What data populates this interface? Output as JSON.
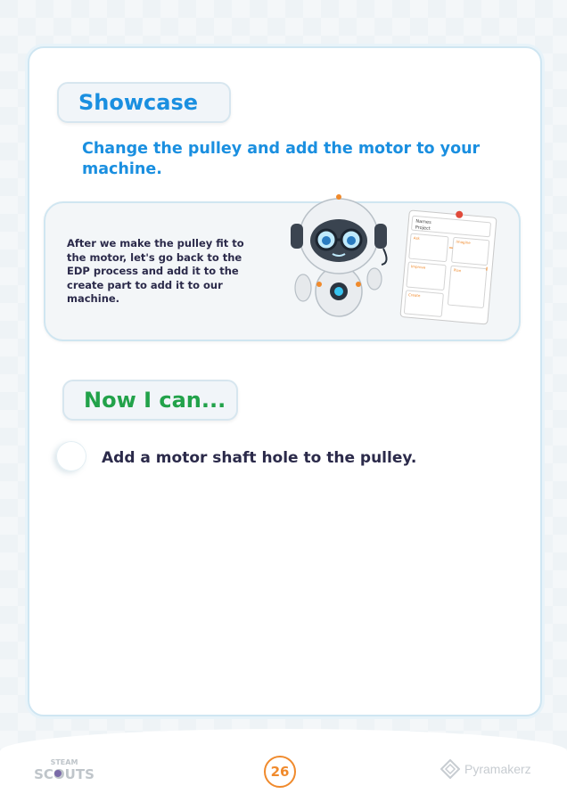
{
  "showcase": {
    "title": "Showcase",
    "subheading": "Change the pulley and add the motor to your machine.",
    "info_text": "After we make the pulley fit to the motor, let's go back to the EDP process and add it to the create part to add it to our machine.",
    "worksheet": {
      "header_lines": [
        "Names",
        "Project"
      ],
      "box_labels": [
        "Ask",
        "Imagine",
        "Improve",
        "Plan",
        "Create"
      ]
    }
  },
  "now_i_can": {
    "title": "Now I can...",
    "items": [
      "Add a motor shaft hole to the pulley."
    ]
  },
  "footer": {
    "left_logo_top": "STEAM",
    "left_logo_bottom": "SCOUTS",
    "page_number": "26",
    "right_logo": "Pyramakerz"
  },
  "colors": {
    "blue_heading": "#1a8fe0",
    "green_heading": "#22a24a",
    "body_text": "#2b2a4a",
    "accent_orange": "#f08a2c"
  }
}
